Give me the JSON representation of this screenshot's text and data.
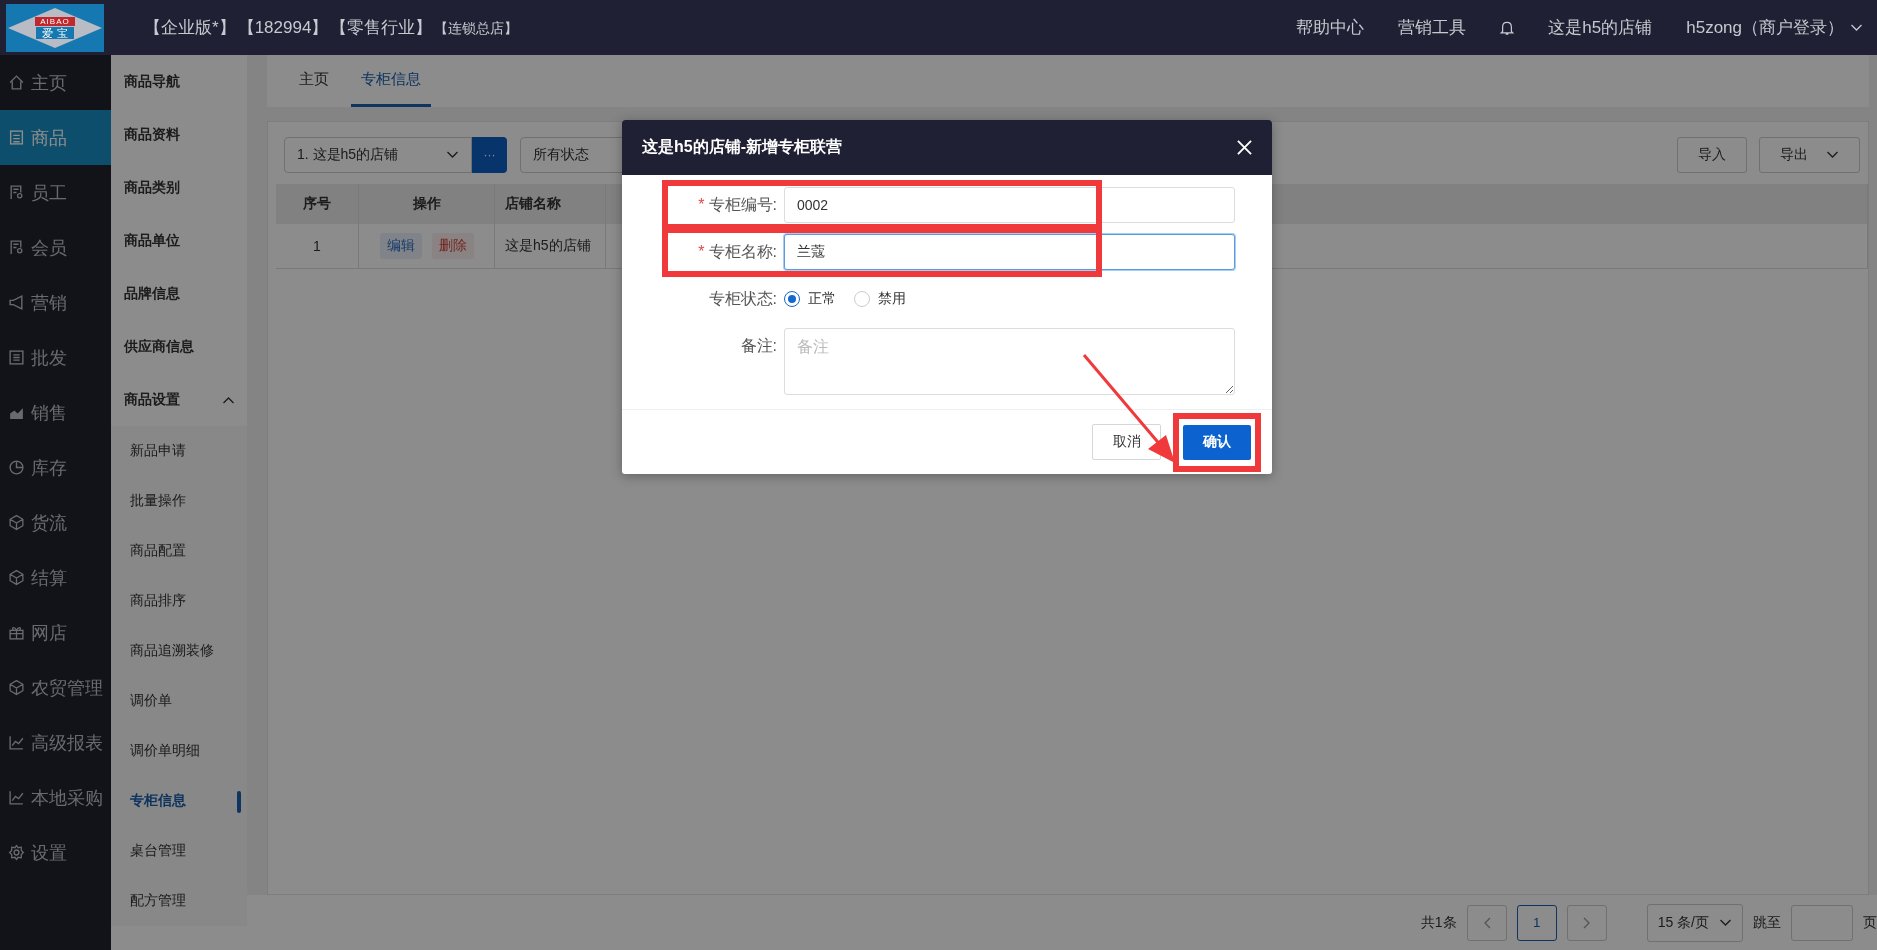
{
  "header": {
    "logo": {
      "top": "AIBAO",
      "bottom": "爱 宝"
    },
    "tags": [
      "【企业版*】",
      "【182994】",
      "【零售行业】"
    ],
    "tag_small": "【连锁总店】",
    "links": [
      "帮助中心",
      "营销工具"
    ],
    "store": "这是h5的店铺",
    "user": "h5zong（商户登录）"
  },
  "nav": [
    {
      "label": "主页",
      "kind": "home",
      "selected": false
    },
    {
      "label": "商品",
      "kind": "doc",
      "selected": true
    },
    {
      "label": "员工",
      "kind": "person",
      "selected": false
    },
    {
      "label": "会员",
      "kind": "person",
      "selected": false
    },
    {
      "label": "营销",
      "kind": "megaphone",
      "selected": false
    },
    {
      "label": "批发",
      "kind": "list",
      "selected": false
    },
    {
      "label": "销售",
      "kind": "area",
      "selected": false
    },
    {
      "label": "库存",
      "kind": "pie",
      "selected": false
    },
    {
      "label": "货流",
      "kind": "cube",
      "selected": false
    },
    {
      "label": "结算",
      "kind": "cube",
      "selected": false
    },
    {
      "label": "网店",
      "kind": "gift",
      "selected": false
    },
    {
      "label": "农贸管理",
      "kind": "cube",
      "selected": false
    },
    {
      "label": "高级报表",
      "kind": "line",
      "selected": false
    },
    {
      "label": "本地采购",
      "kind": "line",
      "selected": false
    },
    {
      "label": "设置",
      "kind": "gear",
      "selected": false
    }
  ],
  "submenu": [
    {
      "label": "商品导航"
    },
    {
      "label": "商品资料"
    },
    {
      "label": "商品类别"
    },
    {
      "label": "商品单位"
    },
    {
      "label": "品牌信息"
    },
    {
      "label": "供应商信息"
    },
    {
      "label": "商品设置",
      "expanded": true,
      "children": [
        {
          "label": "新品申请",
          "selected": false
        },
        {
          "label": "批量操作",
          "selected": false
        },
        {
          "label": "商品配置",
          "selected": false
        },
        {
          "label": "商品排序",
          "selected": false
        },
        {
          "label": "商品追溯装修",
          "selected": false
        },
        {
          "label": "调价单",
          "selected": false
        },
        {
          "label": "调价单明细",
          "selected": false
        },
        {
          "label": "专柜信息",
          "selected": true
        },
        {
          "label": "桌台管理",
          "selected": false
        },
        {
          "label": "配方管理",
          "selected": false
        }
      ]
    }
  ],
  "tabs": [
    {
      "label": "主页",
      "selected": false
    },
    {
      "label": "专柜信息",
      "selected": true
    }
  ],
  "toolbar": {
    "store_select": "1. 这是h5的店铺",
    "more_button": "···",
    "status_select": "所有状态",
    "import_button": "导入",
    "export_button": "导出"
  },
  "table": {
    "columns": [
      "序号",
      "操作",
      "店铺名称"
    ],
    "rows": [
      {
        "index": "1",
        "actions": [
          "编辑",
          "删除"
        ],
        "store": "这是h5的店铺"
      }
    ]
  },
  "pagination": {
    "total": "共1条",
    "pages": [
      {
        "label": "1",
        "selected": true
      }
    ],
    "page_size": "15 条/页",
    "jump_label": "跳至",
    "page_suffix": "页"
  },
  "dialog": {
    "title": "这是h5的店铺-新增专柜联营",
    "required_mark": "*",
    "fields": [
      {
        "kind": "input",
        "label": "专柜编号:",
        "required": true,
        "value": "0002",
        "focused": false,
        "highlighted": true
      },
      {
        "kind": "input",
        "label": "专柜名称:",
        "required": true,
        "value": "兰蔻",
        "focused": true,
        "highlighted": true
      },
      {
        "kind": "radio",
        "label": "专柜状态:",
        "required": false,
        "options": [
          {
            "label": "正常",
            "selected": true
          },
          {
            "label": "禁用",
            "selected": false
          }
        ]
      },
      {
        "kind": "textarea",
        "label": "备注:",
        "required": false,
        "placeholder": "备注"
      }
    ],
    "cancel_button": "取消",
    "confirm_button": {
      "label": "确认",
      "highlighted": true
    },
    "arrow": true
  }
}
